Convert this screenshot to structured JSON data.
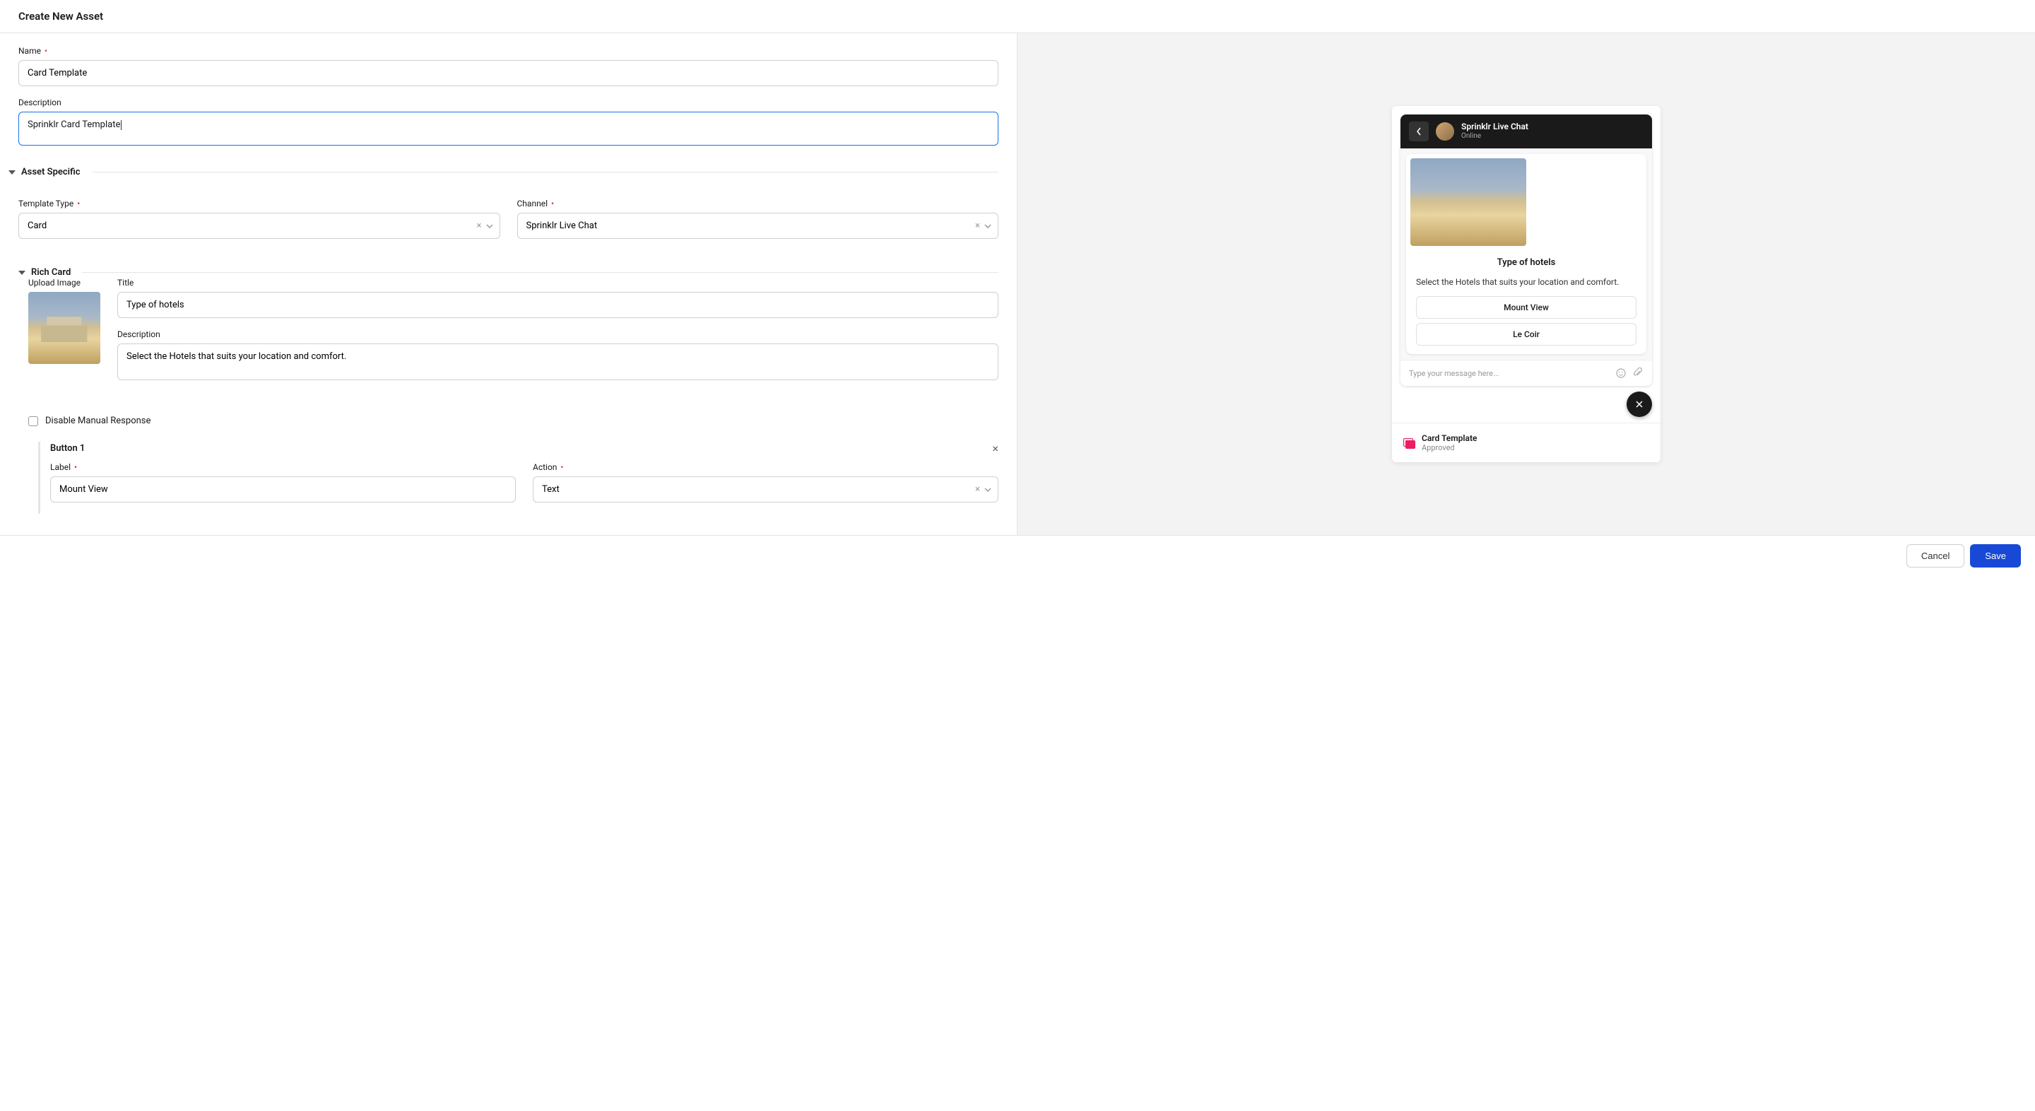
{
  "page_title": "Create New Asset",
  "name_field": {
    "label": "Name",
    "value": "Card Template"
  },
  "description_field": {
    "label": "Description",
    "value": "Sprinklr Card Template"
  },
  "asset_specific": {
    "section_label": "Asset Specific",
    "template_type": {
      "label": "Template Type",
      "value": "Card"
    },
    "channel": {
      "label": "Channel",
      "value": "Sprinklr Live Chat"
    }
  },
  "rich_card": {
    "section_label": "Rich Card",
    "upload_label": "Upload Image",
    "title": {
      "label": "Title",
      "value": "Type of hotels"
    },
    "description": {
      "label": "Description",
      "value": "Select the Hotels that suits your location and comfort."
    },
    "disable_manual_label": "Disable Manual Response",
    "button1": {
      "header": "Button 1",
      "label_label": "Label",
      "label_value": "Mount View",
      "action_label": "Action",
      "action_value": "Text"
    }
  },
  "preview": {
    "chat_title": "Sprinklr Live Chat",
    "chat_status": "Online",
    "card_title": "Type of hotels",
    "card_desc": "Select the Hotels that suits your location and comfort.",
    "btn1": "Mount View",
    "btn2": "Le Coir",
    "input_placeholder": "Type your message here...",
    "template_name": "Card Template",
    "template_status": "Approved"
  },
  "footer": {
    "cancel": "Cancel",
    "save": "Save"
  }
}
